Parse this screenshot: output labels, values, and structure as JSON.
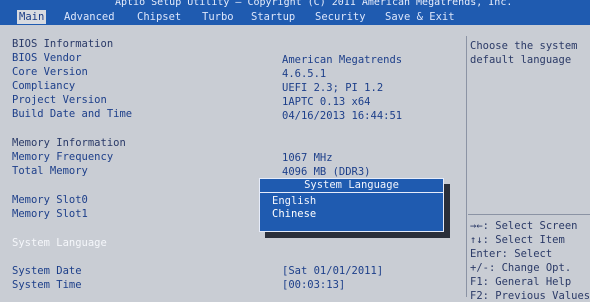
{
  "title": "Aptio Setup Utility – Copyright (C) 2011 American Megatrends, Inc.",
  "tabs": [
    "Main",
    "Advanced",
    "Chipset",
    "Turbo",
    "Startup",
    "Security",
    "Save & Exit"
  ],
  "main": {
    "bios_info_label": "BIOS Information",
    "bios_vendor_label": "BIOS Vendor",
    "bios_vendor_value": "American Megatrends",
    "core_version_label": "Core Version",
    "core_version_value": "4.6.5.1",
    "compliancy_label": "Compliancy",
    "compliancy_value": "UEFI 2.3; PI 1.2",
    "project_version_label": "Project Version",
    "project_version_value": "1APTC 0.13 x64",
    "build_date_label": "Build Date and Time",
    "build_date_value": "04/16/2013 16:44:51",
    "memory_info_label": "Memory Information",
    "memory_freq_label": "Memory Frequency",
    "memory_freq_value": "1067 MHz",
    "total_memory_label": "Total Memory",
    "total_memory_value": "4096 MB (DDR3)",
    "memory_slot0_label": "Memory Slot0",
    "memory_slot1_label": "Memory Slot1",
    "system_language_label": "System Language",
    "system_date_label": "System Date",
    "system_date_value": "[Sat 01/01/2011]",
    "system_time_label": "System Time",
    "system_time_value": "[00:03:13]"
  },
  "help": {
    "text": "Choose the system default language"
  },
  "keys": [
    "→←: Select Screen",
    "↑↓: Select Item",
    "Enter: Select",
    "+/-: Change Opt.",
    "F1: General Help",
    "F2: Previous Values"
  ],
  "popup": {
    "title": "System Language",
    "options": [
      "English",
      "Chinese"
    ],
    "selected": "Chinese"
  }
}
